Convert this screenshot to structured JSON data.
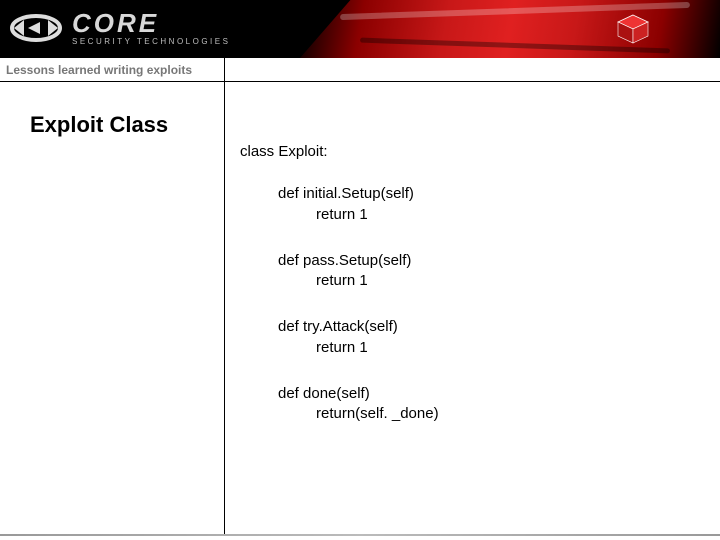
{
  "header": {
    "brand": "CORE",
    "brand_sub": "SECURITY TECHNOLOGIES"
  },
  "breadcrumb": "Lessons learned writing exploits",
  "slide": {
    "title": "Exploit Class",
    "code": {
      "class_decl": "class Exploit:",
      "defs": [
        {
          "sig": "def initial.Setup(self)",
          "ret": "return 1"
        },
        {
          "sig": "def pass.Setup(self)",
          "ret": "return 1"
        },
        {
          "sig": "def try.Attack(self)",
          "ret": "return 1"
        },
        {
          "sig": "def done(self)",
          "ret": "return(self. _done)"
        }
      ]
    }
  }
}
